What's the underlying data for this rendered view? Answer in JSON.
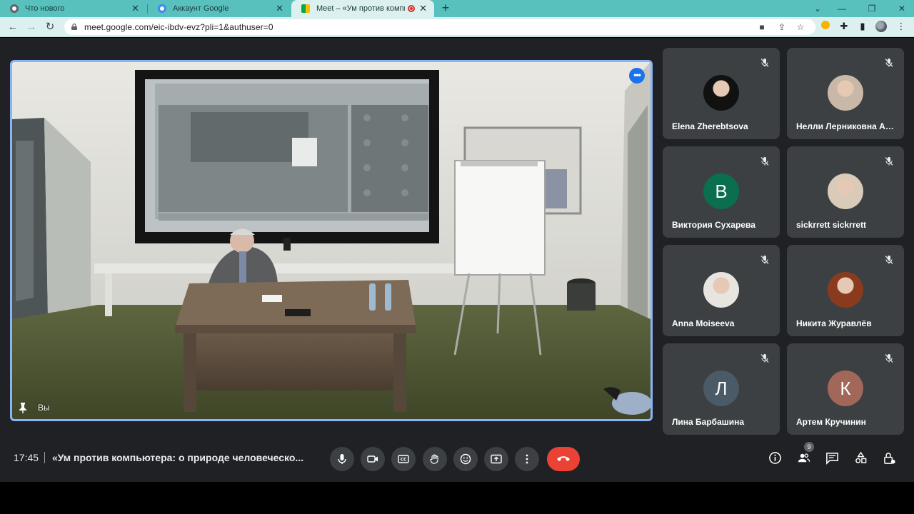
{
  "browser": {
    "tabs": [
      {
        "title": "Что нового",
        "favicon_color": "#5f6368"
      },
      {
        "title": "Аккаунт Google",
        "favicon_color": "#4285f4"
      },
      {
        "title": "Meet – «Ум против компью",
        "favicon_color": "#00ac47",
        "active": true,
        "recording": true
      }
    ],
    "new_tab_label": "+",
    "url": "meet.google.com/eic-ibdv-evz?pli=1&authuser=0",
    "accent_color": "#58c1bd"
  },
  "meeting": {
    "self_label": "Вы",
    "time": "17:45",
    "title": "«Ум против компьютера: о природе человеческо...",
    "participants_count": "9",
    "participants": [
      {
        "name": "Elena Zherebtsova",
        "avatar": "photo",
        "color": "#111111"
      },
      {
        "name": "Нелли Лерниковна Ар...",
        "avatar": "photo",
        "color": "#c9b8a8"
      },
      {
        "name": "Виктория Сухарева",
        "avatar": "В",
        "color": "#0b6e4f"
      },
      {
        "name": "sickrrett sickrrett",
        "avatar": "photo",
        "color": "#d9cbb8"
      },
      {
        "name": "Anna Moiseeva",
        "avatar": "photo",
        "color": "#e8e4e0"
      },
      {
        "name": "Никита Журавлёв",
        "avatar": "photo",
        "color": "#8a3b1e"
      },
      {
        "name": "Лина Барбашина",
        "avatar": "Л",
        "color": "#4a5a66"
      },
      {
        "name": "Артем Кручинин",
        "avatar": "К",
        "color": "#a1685a"
      }
    ],
    "controls": [
      "microphone-icon",
      "camera-icon",
      "captions-icon",
      "raise-hand-icon",
      "emoji-icon",
      "present-icon",
      "more-options-icon",
      "end-call-icon"
    ],
    "right_controls": [
      "info-icon",
      "people-icon",
      "chat-icon",
      "activities-icon",
      "host-controls-icon"
    ],
    "end_call_color": "#ea4335",
    "active_speaker_border": "#8ab4f8"
  }
}
